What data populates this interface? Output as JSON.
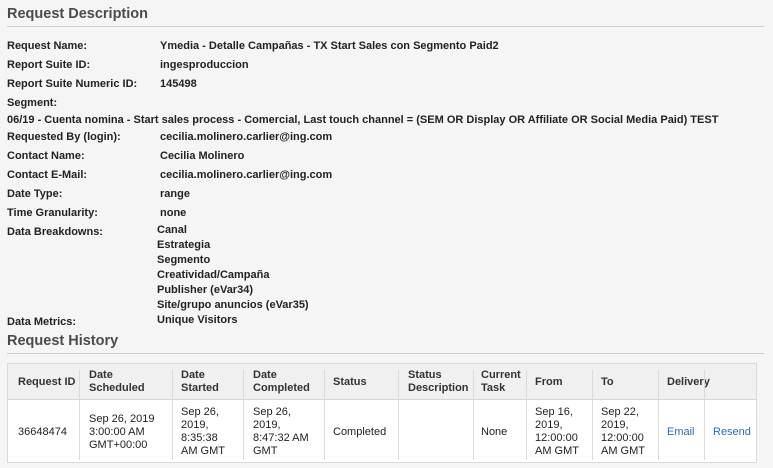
{
  "request_description": {
    "title": "Request Description",
    "fields": {
      "request_name_label": "Request Name:",
      "request_name": "Ymedia - Detalle Campañas - TX Start Sales con Segmento Paid2",
      "report_suite_id_label": "Report Suite ID:",
      "report_suite_id": "ingesproduccion",
      "report_suite_numeric_id_label": "Report Suite Numeric ID:",
      "report_suite_numeric_id": "145498",
      "segment_label": "Segment:",
      "segment": "06/19 - Cuenta nomina - Start sales process - Comercial, Last touch channel = (SEM OR Display OR Affiliate OR Social Media Paid) TEST",
      "requested_by_label": "Requested By (login):",
      "requested_by": "cecilia.molinero.carlier@ing.com",
      "contact_name_label": "Contact Name:",
      "contact_name": "Cecilia Molinero",
      "contact_email_label": "Contact E-Mail:",
      "contact_email": "cecilia.molinero.carlier@ing.com",
      "date_type_label": "Date Type:",
      "date_type": "range",
      "time_granularity_label": "Time Granularity:",
      "time_granularity": "none",
      "data_breakdowns_label": "Data Breakdowns:",
      "data_breakdowns": [
        "Canal",
        "Estrategia",
        "Segmento",
        "Creatividad/Campaña",
        "Publisher (eVar34)",
        "Site/grupo anuncios (eVar35)"
      ],
      "data_metrics_label": "Data Metrics:",
      "data_metrics": "Unique Visitors"
    }
  },
  "request_history": {
    "title": "Request History",
    "columns": {
      "request_id": "Request ID",
      "date_scheduled": [
        "Date",
        "Scheduled"
      ],
      "date_started": [
        "Date",
        "Started"
      ],
      "date_completed": [
        "Date",
        "Completed"
      ],
      "status": "Status",
      "status_description": [
        "Status",
        "Description"
      ],
      "current_task": [
        "Current",
        "Task"
      ],
      "from": "From",
      "to": "To",
      "delivery": "Delivery"
    },
    "rows": [
      {
        "request_id": "36648474",
        "date_scheduled": [
          "Sep 26, 2019",
          "3:00:00 AM",
          "GMT+00:00"
        ],
        "date_started": [
          "Sep 26,",
          "2019,",
          "8:35:38",
          "AM GMT"
        ],
        "date_completed": [
          "Sep 26,",
          "2019,",
          "8:47:32 AM",
          "GMT"
        ],
        "status": "Completed",
        "status_description": "",
        "current_task": "None",
        "from": [
          "Sep 16,",
          "2019,",
          "12:00:00",
          "AM GMT"
        ],
        "to": [
          "Sep 22,",
          "2019,",
          "12:00:00",
          "AM GMT"
        ],
        "email_link": "Email",
        "resend_link": "Resend"
      }
    ]
  },
  "colors": {
    "background": "#f5f5f5",
    "link": "#2a6bb8",
    "header_bg": "#f0f0f0"
  }
}
